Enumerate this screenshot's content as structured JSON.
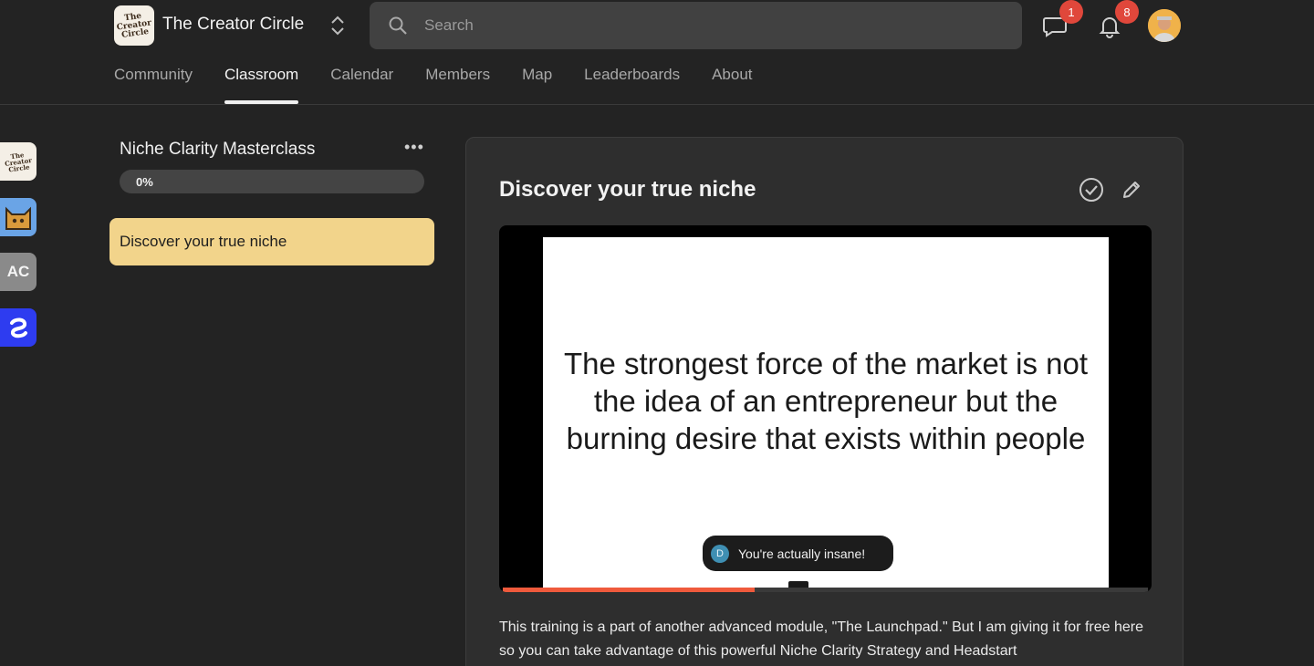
{
  "app": {
    "logo_text": "The Creator Circle",
    "title": "The Creator Circle"
  },
  "search": {
    "placeholder": "Search",
    "value": ""
  },
  "notifications": {
    "chat_count": "1",
    "bell_count": "8"
  },
  "nav": {
    "tabs": [
      {
        "label": "Community"
      },
      {
        "label": "Classroom"
      },
      {
        "label": "Calendar"
      },
      {
        "label": "Members"
      },
      {
        "label": "Map"
      },
      {
        "label": "Leaderboards"
      },
      {
        "label": "About"
      }
    ],
    "active": "Classroom"
  },
  "rail": {
    "items": [
      {
        "label": "The Creator Circle",
        "icon": "creator-circle-logo"
      },
      {
        "label": "",
        "icon": "cat-logo"
      },
      {
        "label": "AC",
        "icon": "initials"
      },
      {
        "label": "",
        "icon": "swirl-logo"
      }
    ]
  },
  "course": {
    "title": "Niche Clarity Masterclass",
    "progress_label": "0%",
    "progress": 0,
    "lessons": [
      {
        "label": "Discover your true niche",
        "active": true
      }
    ]
  },
  "lesson": {
    "title": "Discover your true niche",
    "slide_text": "The strongest force of the market is not the idea of an entrepreneur but the burning desire that exists within people",
    "comment": {
      "initial": "D",
      "text": "You're actually insane!"
    },
    "video_progress": 0.39,
    "description": "This training is a part of another advanced module, \"The Launchpad.\" But I am giving it for free here so you can take advantage of this powerful Niche Clarity Strategy and Headstart"
  },
  "colors": {
    "background": "#232323",
    "active_lesson": "#f2d48b",
    "badge": "#e0473b",
    "video_progress": "#ef5a3c",
    "rail_blue": "#2e3cf0",
    "rail_sky": "#6aa4e6"
  }
}
